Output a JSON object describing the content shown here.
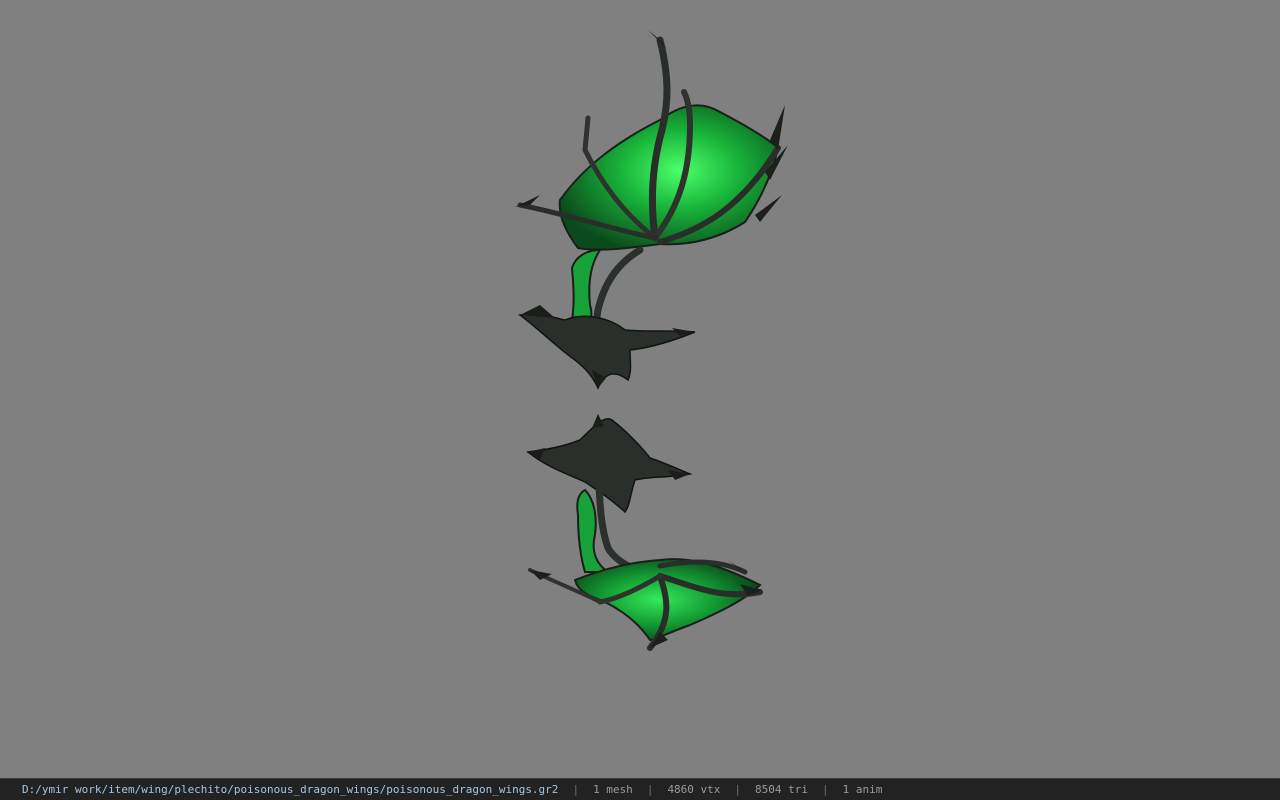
{
  "viewport": {
    "background": "#808080",
    "model_name": "poisonous_dragon_wings",
    "accent_color": "#2bd44c"
  },
  "status": {
    "file_path": "D:/ymir work/item/wing/plechito/poisonous_dragon_wings/poisonous_dragon_wings.gr2",
    "separator": "|",
    "mesh": "1 mesh",
    "vtx": "4860 vtx",
    "tri": "8504 tri",
    "anim": "1 anim"
  }
}
